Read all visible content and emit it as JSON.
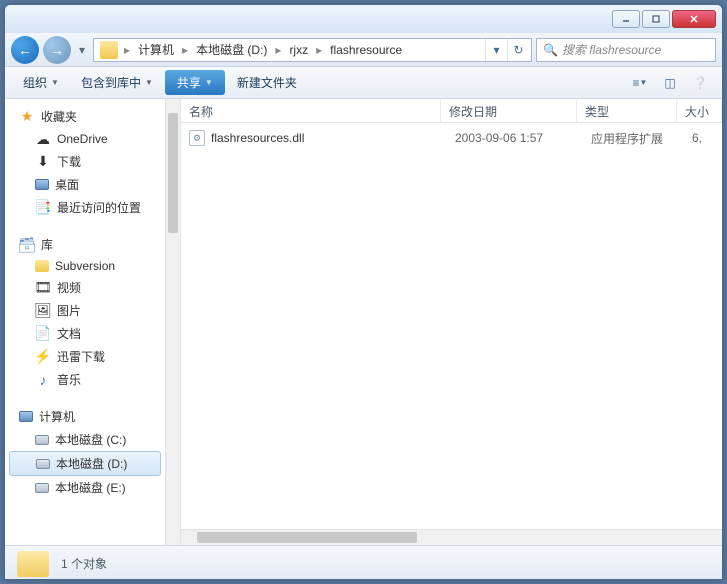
{
  "breadcrumb": [
    "计算机",
    "本地磁盘 (D:)",
    "rjxz",
    "flashresource"
  ],
  "search": {
    "placeholder": "搜索 flashresource"
  },
  "toolbar": {
    "organize": "组织",
    "include": "包含到库中",
    "share": "共享",
    "newfolder": "新建文件夹"
  },
  "sidebar": {
    "favorites": {
      "label": "收藏夹",
      "items": [
        "OneDrive",
        "下载",
        "桌面",
        "最近访问的位置"
      ]
    },
    "libraries": {
      "label": "库",
      "items": [
        "Subversion",
        "视频",
        "图片",
        "文档",
        "迅雷下载",
        "音乐"
      ]
    },
    "computer": {
      "label": "计算机",
      "items": [
        "本地磁盘 (C:)",
        "本地磁盘 (D:)",
        "本地磁盘 (E:)"
      ]
    }
  },
  "columns": {
    "name": "名称",
    "date": "修改日期",
    "type": "类型",
    "size": "大小"
  },
  "files": [
    {
      "name": "flashresources.dll",
      "date": "2003-09-06 1:57",
      "type": "应用程序扩展",
      "size": "6,"
    }
  ],
  "status": "1 个对象"
}
